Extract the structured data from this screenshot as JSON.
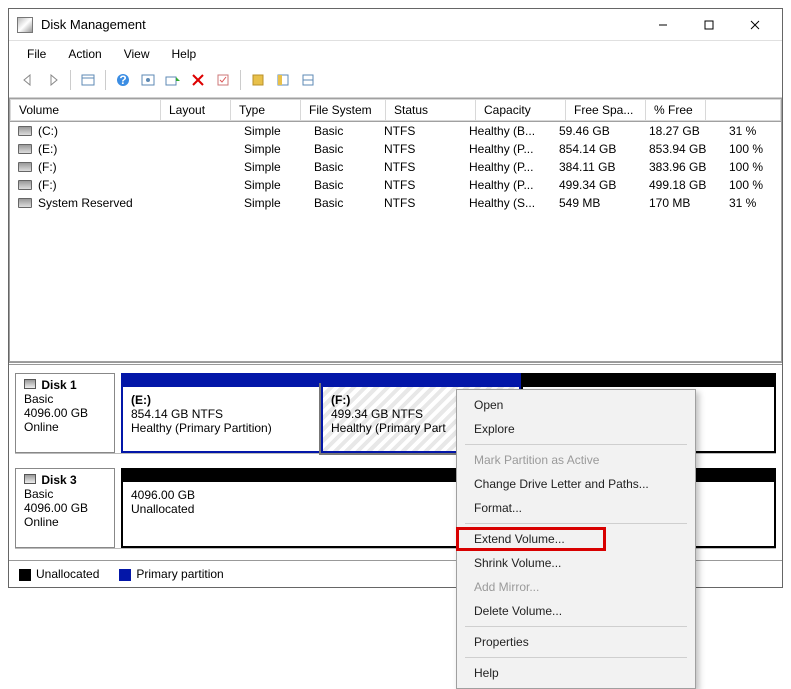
{
  "window": {
    "title": "Disk Management"
  },
  "menu": {
    "file": "File",
    "action": "Action",
    "view": "View",
    "help": "Help"
  },
  "columns": [
    "Volume",
    "Layout",
    "Type",
    "File System",
    "Status",
    "Capacity",
    "Free Spa...",
    "% Free"
  ],
  "volumes": [
    {
      "name": "(C:)",
      "layout": "Simple",
      "type": "Basic",
      "fs": "NTFS",
      "status": "Healthy (B...",
      "capacity": "59.46 GB",
      "free": "18.27 GB",
      "pct": "31 %"
    },
    {
      "name": "(E:)",
      "layout": "Simple",
      "type": "Basic",
      "fs": "NTFS",
      "status": "Healthy (P...",
      "capacity": "854.14 GB",
      "free": "853.94 GB",
      "pct": "100 %"
    },
    {
      "name": "(F:)",
      "layout": "Simple",
      "type": "Basic",
      "fs": "NTFS",
      "status": "Healthy (P...",
      "capacity": "384.11 GB",
      "free": "383.96 GB",
      "pct": "100 %"
    },
    {
      "name": "(F:)",
      "layout": "Simple",
      "type": "Basic",
      "fs": "NTFS",
      "status": "Healthy (P...",
      "capacity": "499.34 GB",
      "free": "499.18 GB",
      "pct": "100 %"
    },
    {
      "name": "System Reserved",
      "layout": "Simple",
      "type": "Basic",
      "fs": "NTFS",
      "status": "Healthy (S...",
      "capacity": "549 MB",
      "free": "170 MB",
      "pct": "31 %"
    }
  ],
  "disk1": {
    "title": "Disk 1",
    "type": "Basic",
    "size": "4096.00 GB",
    "state": "Online",
    "partE": {
      "name": "(E:)",
      "line2": "854.14 GB NTFS",
      "line3": "Healthy (Primary Partition)"
    },
    "partF": {
      "name": "(F:)",
      "line2": "499.34 GB NTFS",
      "line3": "Healthy (Primary Part"
    }
  },
  "disk3": {
    "title": "Disk 3",
    "type": "Basic",
    "size": "4096.00 GB",
    "state": "Online",
    "unalloc": {
      "line1": "4096.00 GB",
      "line2": "Unallocated"
    }
  },
  "legend": {
    "unalloc": "Unallocated",
    "primary": "Primary partition"
  },
  "ctx": {
    "open": "Open",
    "explore": "Explore",
    "mark": "Mark Partition as Active",
    "change": "Change Drive Letter and Paths...",
    "format": "Format...",
    "extend": "Extend Volume...",
    "shrink": "Shrink Volume...",
    "mirror": "Add Mirror...",
    "delete": "Delete Volume...",
    "props": "Properties",
    "help": "Help"
  }
}
